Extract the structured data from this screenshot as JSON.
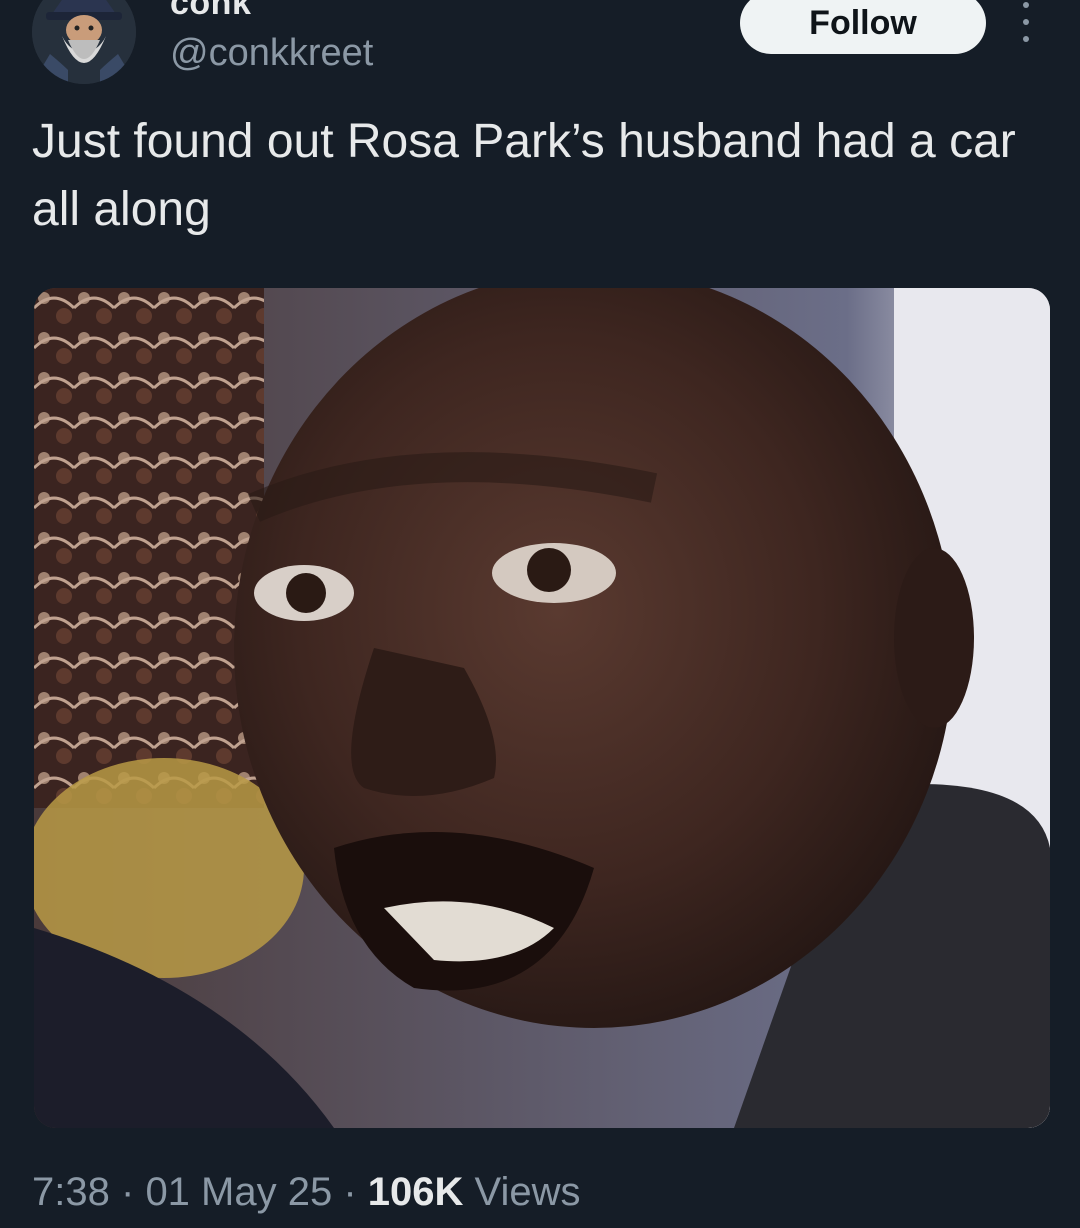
{
  "author": {
    "display_name": "conk",
    "handle": "@conkkreet",
    "avatar_icon": "wizard-avatar-icon"
  },
  "actions": {
    "follow_label": "Follow",
    "more_icon": "more-vertical-icon"
  },
  "tweet": {
    "text": "Just found out Rosa Park’s husband had a car all along"
  },
  "media": {
    "kind": "photo"
  },
  "meta": {
    "time": "7:38",
    "separator": "·",
    "date": "01 May 25",
    "views_count": "106K",
    "views_label": "Views"
  },
  "colors": {
    "background": "#151d27",
    "primary_text": "#e7e9ea",
    "secondary_text": "#8b98a5",
    "follow_button_bg": "#eff3f4"
  }
}
